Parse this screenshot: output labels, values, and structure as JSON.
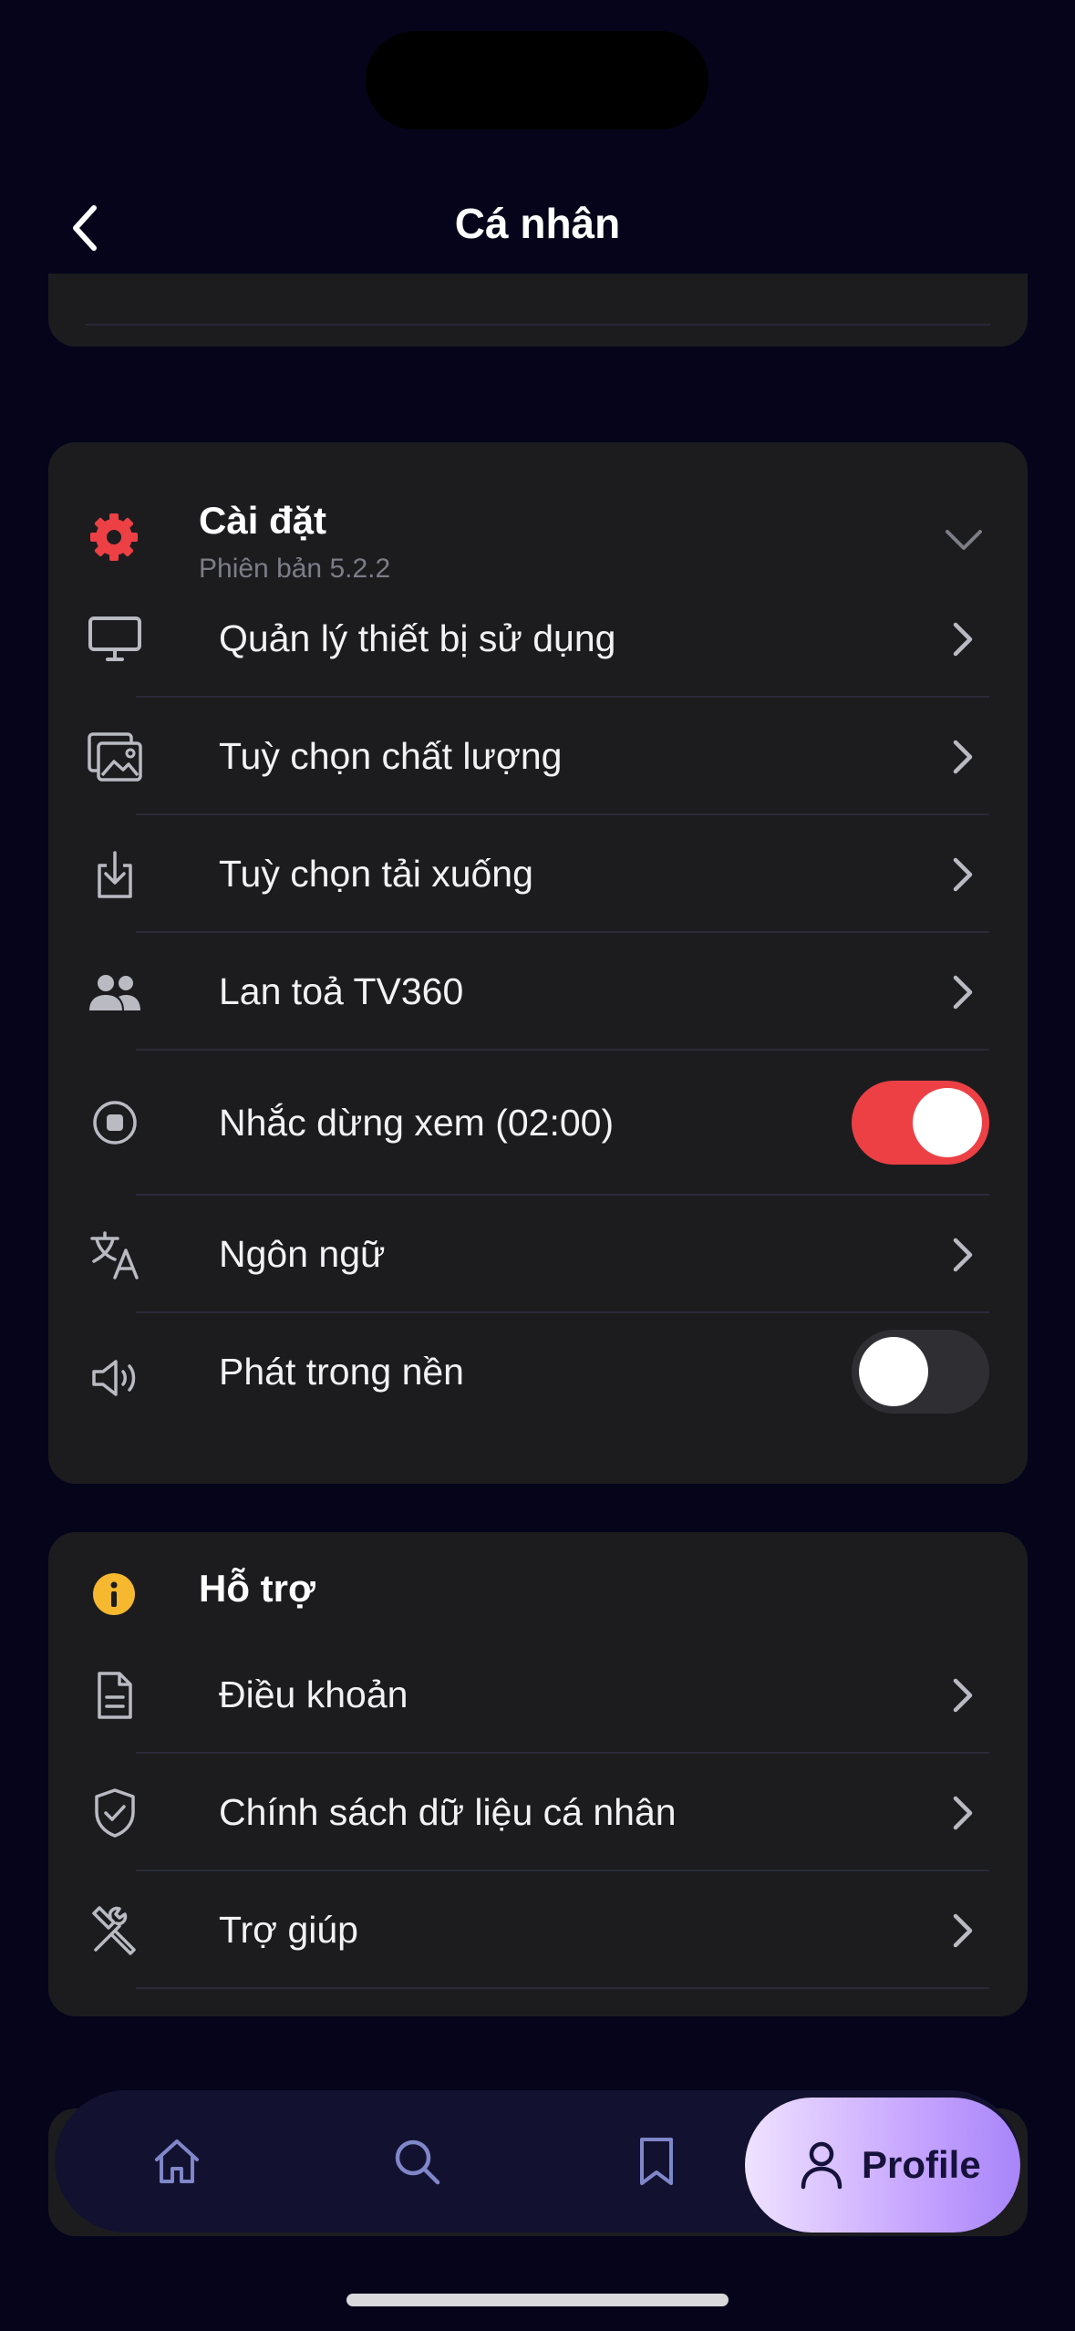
{
  "header": {
    "title": "Cá nhân"
  },
  "settings": {
    "title": "Cài đặt",
    "version": "Phiên bản 5.2.2",
    "items": [
      {
        "label": "Quản lý thiết bị sử dụng",
        "icon": "monitor-icon"
      },
      {
        "label": "Tuỳ chọn chất lượng",
        "icon": "image-quality-icon"
      },
      {
        "label": "Tuỳ chọn tải xuống",
        "icon": "download-icon"
      },
      {
        "label": "Lan toả TV360",
        "icon": "users-icon"
      },
      {
        "label": "Nhắc dừng xem (02:00)",
        "icon": "stop-circle-icon",
        "toggle": true
      },
      {
        "label": "Ngôn ngữ",
        "icon": "translate-icon"
      },
      {
        "label": "Phát trong nền",
        "icon": "speaker-icon",
        "toggle": false
      }
    ]
  },
  "support": {
    "title": "Hỗ trợ",
    "items": [
      {
        "label": "Điều khoản",
        "icon": "document-icon"
      },
      {
        "label": "Chính sách dữ liệu cá nhân",
        "icon": "shield-check-icon"
      },
      {
        "label": "Trợ giúp",
        "icon": "tools-icon"
      }
    ]
  },
  "nav": {
    "items": [
      "home-icon",
      "search-icon",
      "bookmark-icon"
    ],
    "profile_label": "Profile"
  },
  "colors": {
    "accent_red": "#ec4045",
    "warning_yellow": "#f5b82e",
    "background": "#05041a",
    "card": "#1c1c1f"
  }
}
